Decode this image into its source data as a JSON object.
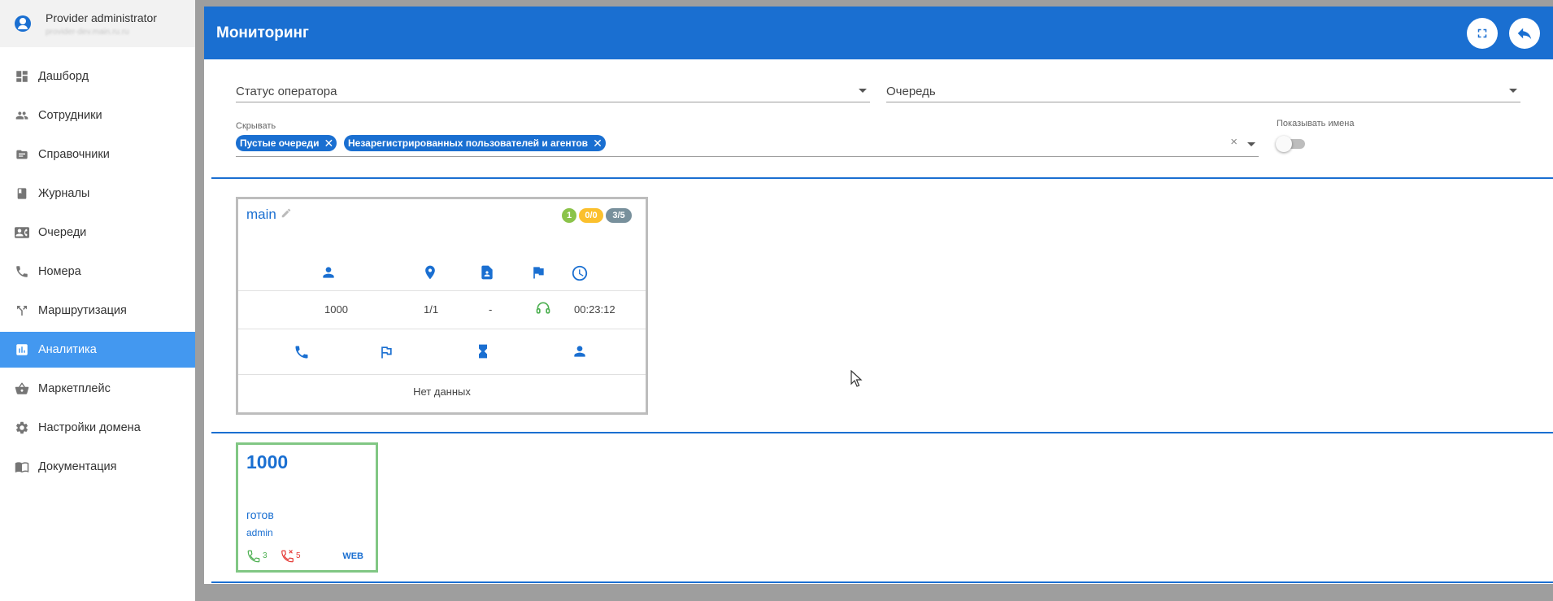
{
  "user": {
    "name": "Provider administrator",
    "subtitle": "provider-dev.main.ru.ru"
  },
  "sidebar": {
    "items": [
      {
        "label": "Дашборд",
        "icon": "dashboard-icon"
      },
      {
        "label": "Сотрудники",
        "icon": "people-icon"
      },
      {
        "label": "Справочники",
        "icon": "folder-icon"
      },
      {
        "label": "Журналы",
        "icon": "book-icon"
      },
      {
        "label": "Очереди",
        "icon": "contacts-icon"
      },
      {
        "label": "Номера",
        "icon": "phone-icon"
      },
      {
        "label": "Маршрутизация",
        "icon": "routing-icon"
      },
      {
        "label": "Аналитика",
        "icon": "analytics-icon",
        "active": true
      },
      {
        "label": "Маркетплейс",
        "icon": "basket-icon"
      },
      {
        "label": "Настройки домена",
        "icon": "gear-icon"
      },
      {
        "label": "Документация",
        "icon": "docs-icon"
      }
    ]
  },
  "header": {
    "title": "Мониторинг",
    "buttons": [
      "fullscreen-icon",
      "back-icon"
    ]
  },
  "filters": {
    "operator_status": {
      "label": "Статус оператора",
      "value": ""
    },
    "queue": {
      "label": "Очередь",
      "value": ""
    },
    "hide": {
      "label": "Скрывать",
      "chips": [
        "Пустые очереди",
        "Незарегистрированных пользователей и агентов"
      ],
      "clear": "×"
    },
    "show_names": {
      "label": "Показывать имена",
      "on": false
    }
  },
  "queue_card": {
    "name": "main",
    "badges": [
      {
        "text": "1",
        "color": "#8bc34a"
      },
      {
        "text": "0/0",
        "color": "#fbc02d"
      },
      {
        "text": "3/5",
        "color": "#78909c"
      }
    ],
    "column_icons": [
      "person-icon",
      "location-pin-icon",
      "contact-card-icon",
      "flag-icon",
      "clock-icon"
    ],
    "row": {
      "agent": "1000",
      "position": "1/1",
      "state": "-",
      "status_icon": "headset-icon",
      "time": "00:23:12"
    },
    "stat_icons": [
      "phone-icon",
      "flag-outline-icon",
      "hourglass-icon",
      "person-icon"
    ],
    "empty_text": "Нет данных"
  },
  "agent_card": {
    "number": "1000",
    "status": "готов",
    "user": "admin",
    "answered": "3",
    "missed": "5",
    "channel": "WEB",
    "colors": {
      "border": "#81c784",
      "answered": "#4caf50",
      "missed": "#e53935"
    }
  },
  "colors": {
    "brand": "#1a6fd1",
    "active_nav": "#4398f0",
    "background": "#9e9e9e"
  }
}
